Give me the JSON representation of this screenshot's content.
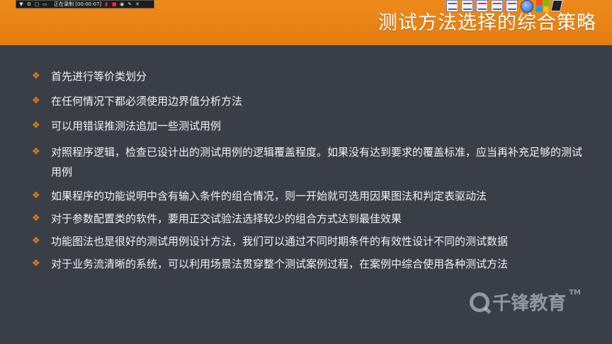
{
  "recorder": {
    "status_text": "正在录制 [00:00:07]",
    "icons": [
      "dropdown-icon",
      "settings-icon",
      "camera-icon",
      "record-icon",
      "stop-icon",
      "snapshot-icon",
      "pen-icon",
      "close-icon"
    ]
  },
  "slide": {
    "title": "测试方法选择的综合策略",
    "bullet_color": "#e8821a",
    "header_color": "#e8841a",
    "bullets": [
      "首先进行等价类划分",
      "在任何情况下都必须使用边界值分析方法",
      "可以用错误推测法追加一些测试用例",
      "对照程序逻辑，检查已设计出的测试用例的逻辑覆盖程度。如果没有达到要求的覆盖标准，应当再补充足够的测试用例",
      "如果程序的功能说明中含有输入条件的组合情况，则一开始就可选用因果图法和判定表驱动法",
      "对于参数配置类的软件，要用正交试验法选择较少的组合方式达到最佳效果",
      "功能图法也是很好的测试用例设计方法，我们可以通过不同时期条件的有效性设计不同的测试数据",
      "对于业务流清晰的系统，可以利用场景法贯穿整个测试案例过程，在案例中综合使用各种测试方法"
    ]
  },
  "watermark": {
    "brand": "千锋教育",
    "trademark": "TM"
  }
}
